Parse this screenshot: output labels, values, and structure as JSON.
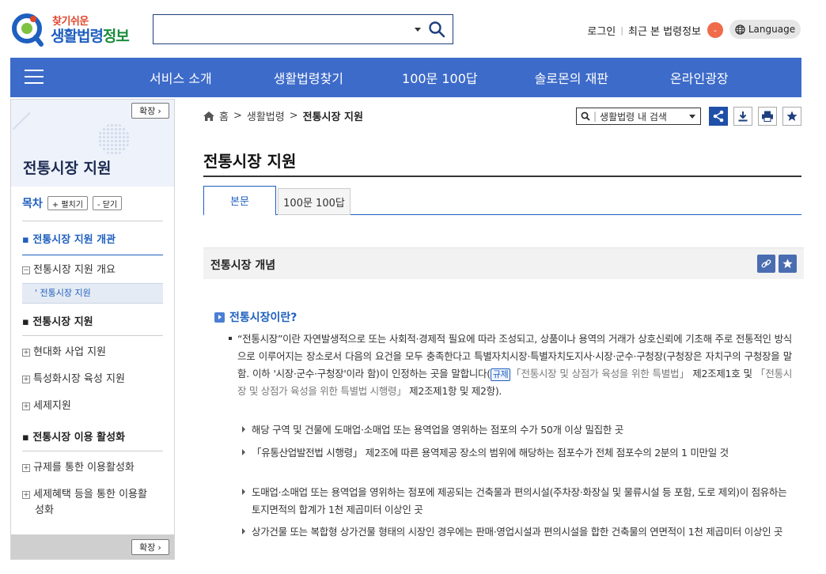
{
  "header": {
    "logo_small": "찾기쉬운",
    "logo_big_main": "생활법령",
    "logo_big_accent": "정보",
    "search_placeholder": "",
    "login": "로그인",
    "recent": "최근 본 법령정보",
    "recent_badge": "-",
    "language": "Language"
  },
  "nav": {
    "items": [
      "서비스 소개",
      "생활법령찾기",
      "100문 100답",
      "솔로몬의 재판",
      "온라인광장"
    ]
  },
  "sidebar": {
    "expand_label": "확장",
    "title": "전통시장 지원",
    "toc_label": "목차",
    "expand_all": "+ 펼치기",
    "collapse_all": "- 닫기",
    "items": [
      {
        "label": "전통시장 지원 개관"
      },
      {
        "label": "전통시장 지원 개요",
        "marker": "−"
      },
      {
        "label": "전통시장 지원"
      },
      {
        "label": "전통시장 지원"
      },
      {
        "label": "현대화 사업 지원",
        "marker": "+"
      },
      {
        "label": "특성화시장 육성 지원",
        "marker": "+"
      },
      {
        "label": "세제지원",
        "marker": "+"
      },
      {
        "label": "전통시장 이용 활성화"
      },
      {
        "label": "규제를 통한 이용활성화",
        "marker": "+"
      },
      {
        "label": "세제혜택 등을 통한 이용활",
        "marker": "+"
      },
      {
        "label": "성화"
      }
    ]
  },
  "breadcrumb": {
    "home": "홈",
    "level1": "생활법령",
    "current": "전통시장 지원",
    "sep": ">"
  },
  "tools": {
    "inner_search": "생활법령 내 검색"
  },
  "content": {
    "page_title": "전통시장 지원",
    "tabs": [
      "본문",
      "100문 100답"
    ],
    "section_title": "전통시장 개념",
    "question": "전통시장이란?",
    "body_part1": "“전통시장”이란 자연발생적으로 또는 사회적·경제적 필요에 따라 조성되고, 상품이나 용역의 거래가 상호신뢰에 기초해 주로 전통적인 방식으로 이루어지는 장소로서 다음의 요건을 모두 충족한다고 특별자치시장·특별자치도지사·시장·군수·구청장(구청장은 자치구의 구청장을 말함. 이하 '시장·군수·구청장'이라 함)이 인정하는 곳을 말합니다",
    "reg_tag": "규제",
    "law1": "「전통시장 및 상점가 육성을 위한 특별법」",
    "body_part2": " 제2조제1호 및 ",
    "law2": "「전통시장 및 상점가 육성을 위한 특별법 시행령」",
    "body_part3": " 제2조제1항 및 제2항).",
    "sub_items": [
      "해당 구역 및 건물에 도매업·소매업 또는 용역업을 영위하는 점포의 수가 50개 이상 밀집한 곳",
      "「유통산업발전법 시행령」 제2조에 따른 용역제공 장소의 범위에 해당하는 점포수가 전체 점포수의 2분의 1 미만일 것",
      "도매업·소매업 또는 용역업을 영위하는 점포에 제공되는 건축물과 편의시설(주차장·화장실 및 물류시설 등 포함, 도로 제외)이 점유하는 토지면적의 합계가 1천 제곱미터 이상인 곳",
      "상가건물 또는 복합형 상가건물 형태의 시장인 경우에는 판매·영업시설과 편의시설을 합한 건축물의 연면적이 1천 제곱미터 이상인 곳"
    ]
  },
  "colors": {
    "nav_bg": "#3d6bc9",
    "accent_blue": "#1f5fbf",
    "badge_orange": "#f06b4a"
  }
}
